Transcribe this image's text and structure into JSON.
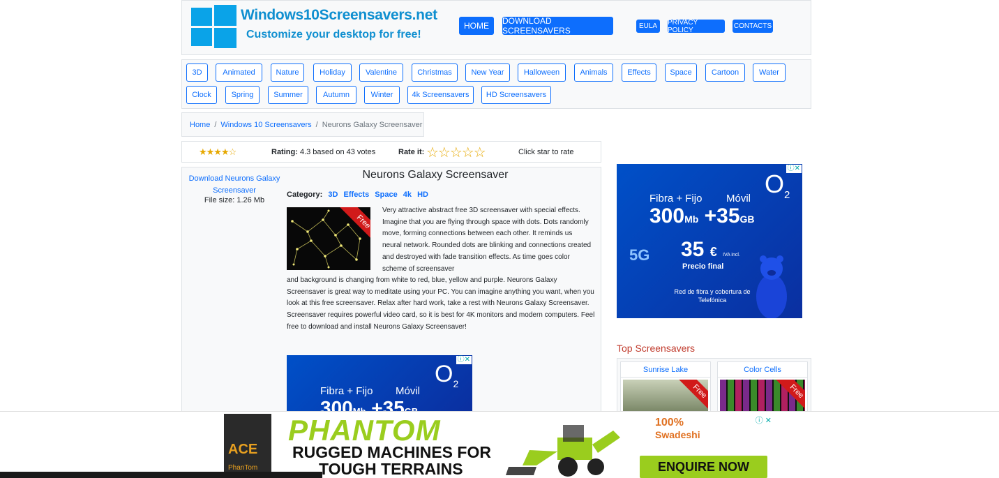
{
  "site": {
    "name": "Windows10Screensavers.net",
    "tagline": "Customize your desktop for free!"
  },
  "nav": {
    "main": [
      "HOME",
      "DOWNLOAD SCREENSAVERS"
    ],
    "small": [
      "EULA",
      "PRIVACY POLICY",
      "CONTACTS"
    ]
  },
  "categories": [
    "3D",
    "Animated",
    "Nature",
    "Holiday",
    "Valentine",
    "Christmas",
    "New Year",
    "Halloween",
    "Animals",
    "Effects",
    "Space",
    "Cartoon",
    "Water",
    "Clock",
    "Spring",
    "Summer",
    "Autumn",
    "Winter",
    "4k Screensavers",
    "HD Screensavers"
  ],
  "breadcrumb": {
    "home": "Home",
    "section": "Windows 10 Screensavers",
    "current": "Neurons Galaxy Screensaver",
    "sep": "/"
  },
  "rating": {
    "avg_stars": "★★★★☆",
    "label": "Rating:",
    "text": "4.3 based on 43 votes",
    "rate_label": "Rate it:",
    "rate_stars": "☆☆☆☆☆",
    "hint": "Click star to rate",
    "value": 4.3,
    "max": 5,
    "votes": 43
  },
  "sidebar": {
    "download_label": "Download Neurons Galaxy Screensaver",
    "file_size": "File size: 1.26 Mb"
  },
  "article": {
    "title": "Neurons Galaxy Screensaver",
    "category_label": "Category:",
    "tags": [
      "3D",
      "Effects",
      "Space",
      "4k",
      "HD"
    ],
    "ribbon": "Free",
    "desc_part1": "Very attractive abstract free 3D screensaver with special effects. Imagine that you are flying through space with dots. Dots randomly move, forming connections between each other. It reminds us neural network. Rounded dots are blinking and connections created and destroyed with fade transition effects. As time goes color scheme of screensaver",
    "desc_part2": "and background is changing from white to red, blue, yellow and purple. Neurons Galaxy Screensaver is great way to meditate using your PC. You can imagine anything you want, when you look at this free screensaver. Relax after hard work, take a rest with Neurons Galaxy Screensaver. Screensaver requires powerful video card, so it is best for 4K monitors and modern computers. Feel free to download and install Neurons Galaxy Screensaver!"
  },
  "ad_o2": {
    "brand": "O",
    "brand_sub": "2",
    "line1_left": "Fibra + Fijo",
    "line1_right": "Móvil",
    "speed": "300",
    "speed_unit": "Mb",
    "plus": "+",
    "data": "35",
    "data_unit": "GB",
    "fiveg": "5G",
    "price": "35",
    "currency": "€",
    "iva": "IVA incl.",
    "price_label": "Precio final",
    "footer": "Red de fibra y cobertura de Telefónica",
    "close": "ⓘ✕"
  },
  "top": {
    "title": "Top Screensavers",
    "items": [
      {
        "name": "Sunrise Lake",
        "ribbon": "Free"
      },
      {
        "name": "Color Cells",
        "ribbon": "Free"
      }
    ]
  },
  "bottom_ad": {
    "brand": "ACE",
    "brand_sub": "PhanTom",
    "headline": "PHANTOM",
    "sub1": "RUGGED MACHINES FOR",
    "sub2": "TOUGH TERRAINS",
    "badge": "100%",
    "badge_sub": "Swadeshi",
    "cta": "ENQUIRE NOW",
    "close": "ⓘ ✕"
  },
  "colors": {
    "primary": "#0d6efd",
    "logo": "#0aa3e8",
    "ribbon": "#d11a1a",
    "star": "#e6a800",
    "phantom_green": "#9acd1e"
  }
}
